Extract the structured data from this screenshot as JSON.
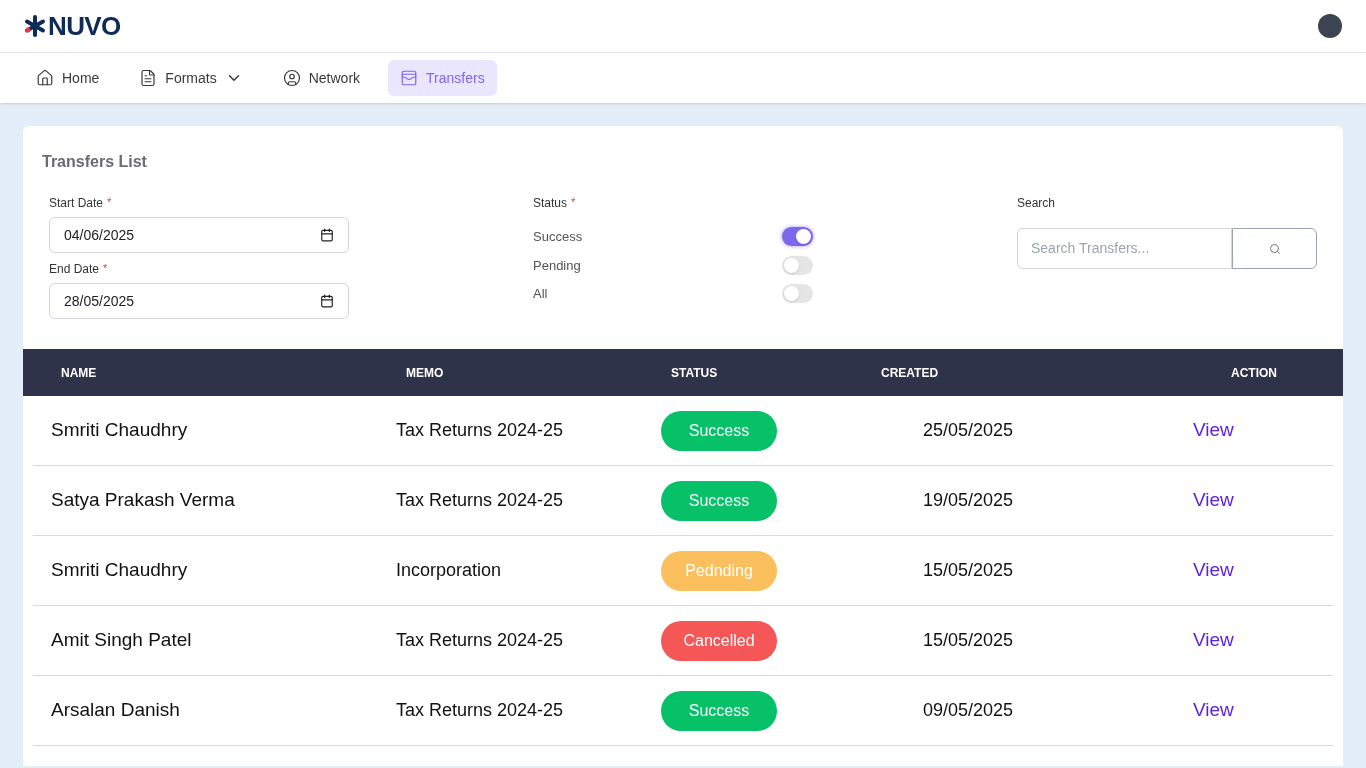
{
  "logo": {
    "text": "NUVO"
  },
  "nav": [
    {
      "label": "Home",
      "kind": "link",
      "selected": false
    },
    {
      "label": "Formats",
      "kind": "menu",
      "selected": false
    },
    {
      "label": "Network",
      "kind": "link",
      "selected": false
    },
    {
      "label": "Transfers",
      "kind": "link",
      "selected": true
    }
  ],
  "panel": {
    "title": "Transfers List",
    "dates": [
      {
        "label": "Start Date",
        "required_mark": "*",
        "value": "04/06/2025"
      },
      {
        "label": "End Date",
        "required_mark": "*",
        "value": "28/05/2025"
      }
    ],
    "status": {
      "label": "Status",
      "required_mark": "*",
      "options": [
        {
          "label": "Success",
          "on": true
        },
        {
          "label": "Pending",
          "on": false
        },
        {
          "label": "All",
          "on": false
        }
      ]
    },
    "search": {
      "label": "Search",
      "placeholder": "Search Transfers..."
    }
  },
  "table": {
    "columns": [
      "NAME",
      "MEMO",
      "STATUS",
      "CREATED",
      "ACTION"
    ],
    "rows": [
      {
        "name": "Smriti Chaudhry",
        "memo": "Tax Returns 2024-25",
        "status": "Success",
        "color": "#06c167",
        "created": "25/05/2025",
        "action": "View"
      },
      {
        "name": "Satya Prakash Verma",
        "memo": "Tax Returns 2024-25",
        "status": "Success",
        "color": "#06c167",
        "created": "19/05/2025",
        "action": "View"
      },
      {
        "name": "Smriti Chaudhry",
        "memo": "Incorporation",
        "status": "Pednding",
        "color": "#fbbf5d",
        "created": "15/05/2025",
        "action": "View"
      },
      {
        "name": "Amit Singh Patel",
        "memo": "Tax Returns 2024-25",
        "status": "Cancelled",
        "color": "#f55656",
        "created": "15/05/2025",
        "action": "View"
      },
      {
        "name": "Arsalan Danish",
        "memo": "Tax Returns 2024-25",
        "status": "Success",
        "color": "#06c167",
        "created": "09/05/2025",
        "action": "View"
      }
    ]
  }
}
